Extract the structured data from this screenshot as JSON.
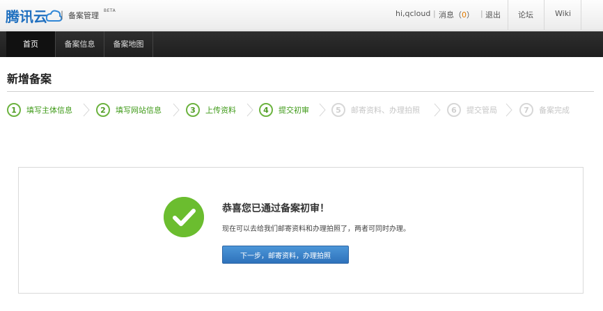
{
  "header": {
    "logo_text": "腾讯云",
    "separator": "|",
    "product_name": "备案管理",
    "product_badge": "BETA",
    "greeting": "hi,qcloud",
    "messages_label": "消息（",
    "messages_count": "0",
    "messages_close": "）",
    "pipe": "|",
    "logout": "退出",
    "forum": "论坛",
    "wiki": "Wiki"
  },
  "nav": {
    "tabs": [
      {
        "label": "首页",
        "active": true
      },
      {
        "label": "备案信息",
        "active": false
      },
      {
        "label": "备案地图",
        "active": false
      }
    ]
  },
  "page": {
    "title": "新增备案"
  },
  "steps": [
    {
      "num": "1",
      "label": "填写主体信息",
      "done": true
    },
    {
      "num": "2",
      "label": "填写网站信息",
      "done": true
    },
    {
      "num": "3",
      "label": "上传资料",
      "done": true
    },
    {
      "num": "4",
      "label": "提交初审",
      "done": true
    },
    {
      "num": "5",
      "label": "邮寄资料、办理拍照",
      "done": false
    },
    {
      "num": "6",
      "label": "提交管局",
      "done": false
    },
    {
      "num": "7",
      "label": "备案完成",
      "done": false
    }
  ],
  "result": {
    "title": "恭喜您已通过备案初审！",
    "subtitle": "现在可以去给我们邮寄资料和办理拍照了，两者可同时办理。",
    "button": "下一步，邮寄资料，办理拍照"
  },
  "colors": {
    "success_green": "#6bbd2f",
    "step_done": "#3f9a18",
    "step_todo": "#c6c6c6",
    "primary_button": "#3a80c6",
    "nav_bg": "#262626",
    "logo_blue": "#1f6fbf"
  }
}
